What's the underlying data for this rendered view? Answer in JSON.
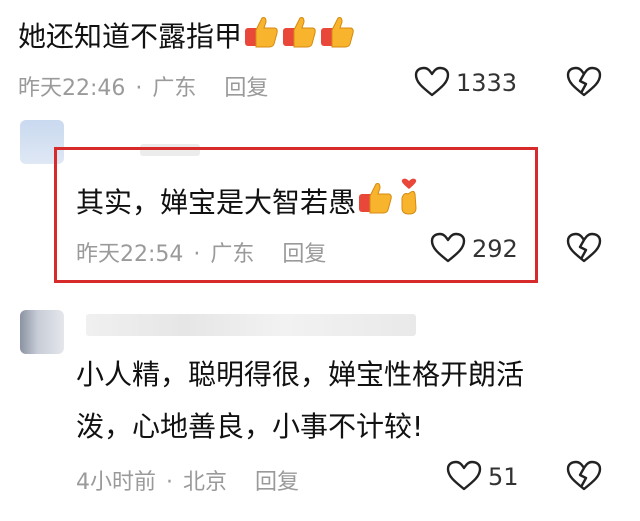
{
  "comments": [
    {
      "text": "她还知道不露指甲",
      "time": "昨天22:46",
      "location": "广东",
      "reply_label": "回复",
      "likes": "1333",
      "emoji": [
        "thumbs-up",
        "thumbs-up",
        "thumbs-up"
      ]
    },
    {
      "text": "其实，婵宝是大智若愚",
      "time": "昨天22:54",
      "location": "广东",
      "reply_label": "回复",
      "likes": "292",
      "emoji": [
        "thumbs-up",
        "finger-heart"
      ]
    },
    {
      "text_line1": "小人精，聪明得很，婵宝性格开朗活",
      "text_line2": "泼，心地善良，小事不计较!",
      "time": "4小时前",
      "location": "北京",
      "reply_label": "回复",
      "likes": "51"
    }
  ],
  "separator": "·",
  "colors": {
    "highlight": "#d72a2a",
    "meta_text": "#9a9a9a",
    "emoji_yellow": "#f7b42c",
    "emoji_red": "#e8473a"
  },
  "icons": [
    "heart-outline-icon",
    "broken-heart-icon",
    "thumbs-up-emoji",
    "finger-heart-emoji"
  ]
}
